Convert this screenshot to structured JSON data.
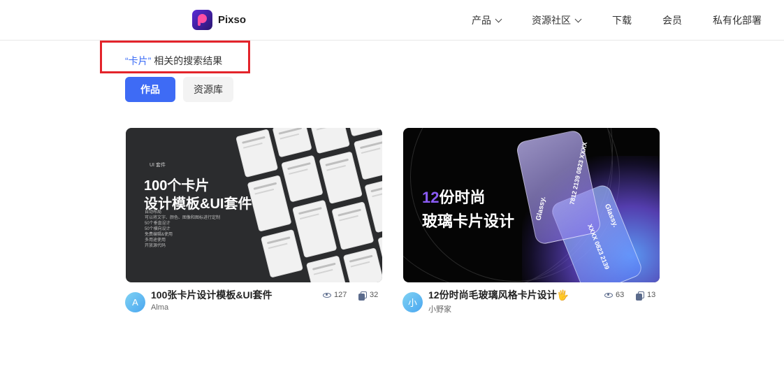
{
  "header": {
    "logo_text": "Pixso",
    "nav": [
      {
        "label": "产品",
        "has_dropdown": true
      },
      {
        "label": "资源社区",
        "has_dropdown": true
      },
      {
        "label": "下载",
        "has_dropdown": false
      },
      {
        "label": "会员",
        "has_dropdown": false
      },
      {
        "label": "私有化部署",
        "has_dropdown": false
      }
    ]
  },
  "search": {
    "keyword": "“卡片”",
    "suffix": " 相关的搜索结果"
  },
  "tabs": [
    {
      "label": "作品",
      "active": true
    },
    {
      "label": "资源库",
      "active": false
    }
  ],
  "cards": [
    {
      "title": "100张卡片设计模板&UI套件",
      "author": "Alma",
      "avatar_letter": "A",
      "views": "127",
      "copies": "32",
      "thumb": {
        "tag": "UI 套件",
        "headline1": "100个卡片",
        "headline2": "设计模板&UI套件",
        "features": [
          "自动布局",
          "可以将文字、颜色、图像和图标进行定制",
          "50个垂直设计",
          "50个横向设计",
          "免费编辑&使用",
          "多用途使用",
          "开放源代码"
        ]
      }
    },
    {
      "title": "12份时尚毛玻璃风格卡片设计🖐",
      "author": "小野家",
      "avatar_letter": "小",
      "views": "63",
      "copies": "13",
      "thumb": {
        "headline1_num": "12",
        "headline1_rest": "份时尚",
        "headline2": "玻璃卡片设计",
        "card_brand_a": "Glassy.",
        "card_number_a": "7812 2139 0823 XXXX",
        "card_brand_b": "Glassy.",
        "card_number_b": "XXXX 0823 2139"
      }
    }
  ],
  "colors": {
    "accent": "#3e6bf5",
    "highlight_box": "#e3242b",
    "keyword": "#3b6cf6"
  }
}
